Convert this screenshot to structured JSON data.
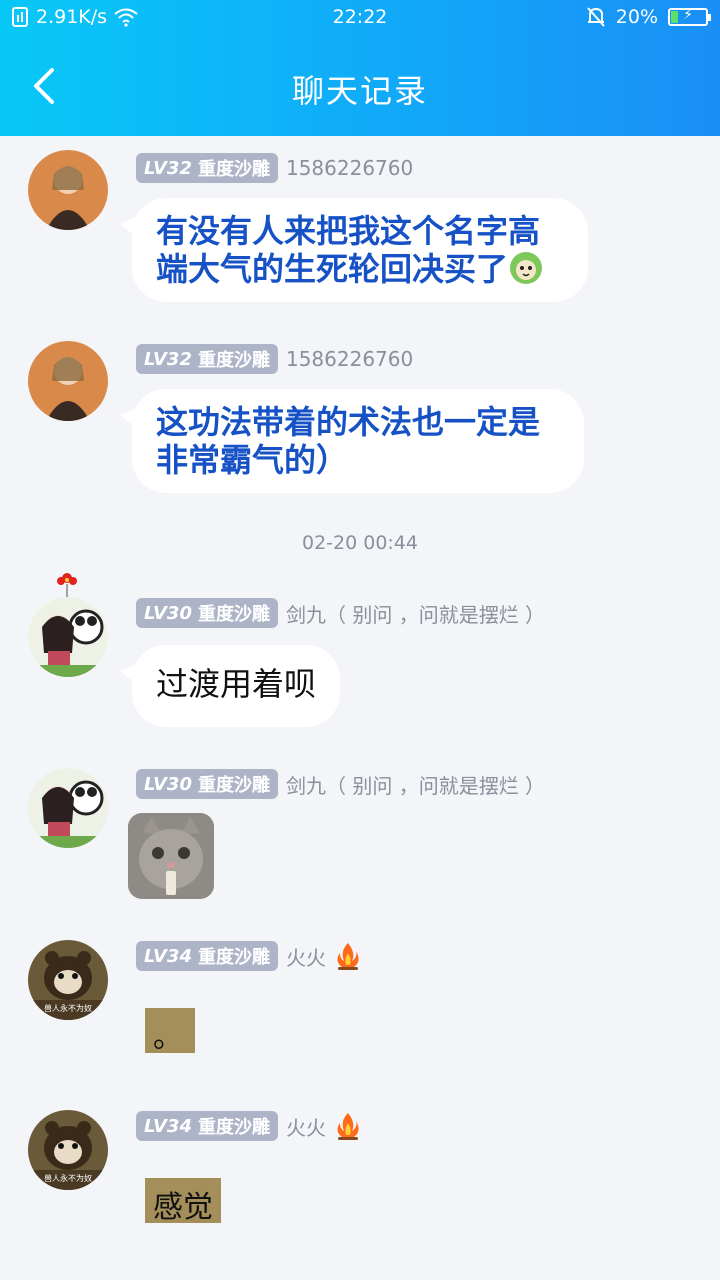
{
  "status": {
    "speed": "2.91K/s",
    "time": "22:22",
    "battery": "20%",
    "accent_gradient": [
      "#08c8f7",
      "#1a8ff7"
    ],
    "battery_level": 0.2
  },
  "nav": {
    "title": "聊天记录"
  },
  "messages": [
    {
      "level": "LV32",
      "title": "重度沙雕",
      "nickname": "1586226760",
      "text": "有没有人来把我这个名字高端大气的生死轮回决买了",
      "text_line1": "有没有人来把我这个名字高",
      "text_line2": "端大气的生死轮回决买了"
    },
    {
      "level": "LV32",
      "title": "重度沙雕",
      "nickname": "1586226760",
      "text_line1": "这功法带着的术法也一定是",
      "text_line2": "非常霸气的）"
    },
    {
      "level": "LV30",
      "title": "重度沙雕",
      "nickname": "剑九（ 别问 ，问就是摆烂 ）",
      "text": "过渡用着呗"
    },
    {
      "level": "LV30",
      "title": "重度沙雕",
      "nickname": "剑九（ 别问 ，问就是摆烂 ）",
      "sticker": "cat-sticker-icon"
    },
    {
      "level": "LV34",
      "title": "重度沙雕",
      "nickname": "火火",
      "nickname_icon": "campfire-icon",
      "text": "。"
    },
    {
      "level": "LV34",
      "title": "重度沙雕",
      "nickname": "火火",
      "nickname_icon": "campfire-icon",
      "text": "感觉"
    }
  ],
  "timestamp": "02-20 00:44",
  "avatar_caption": "兽人永不为奴"
}
